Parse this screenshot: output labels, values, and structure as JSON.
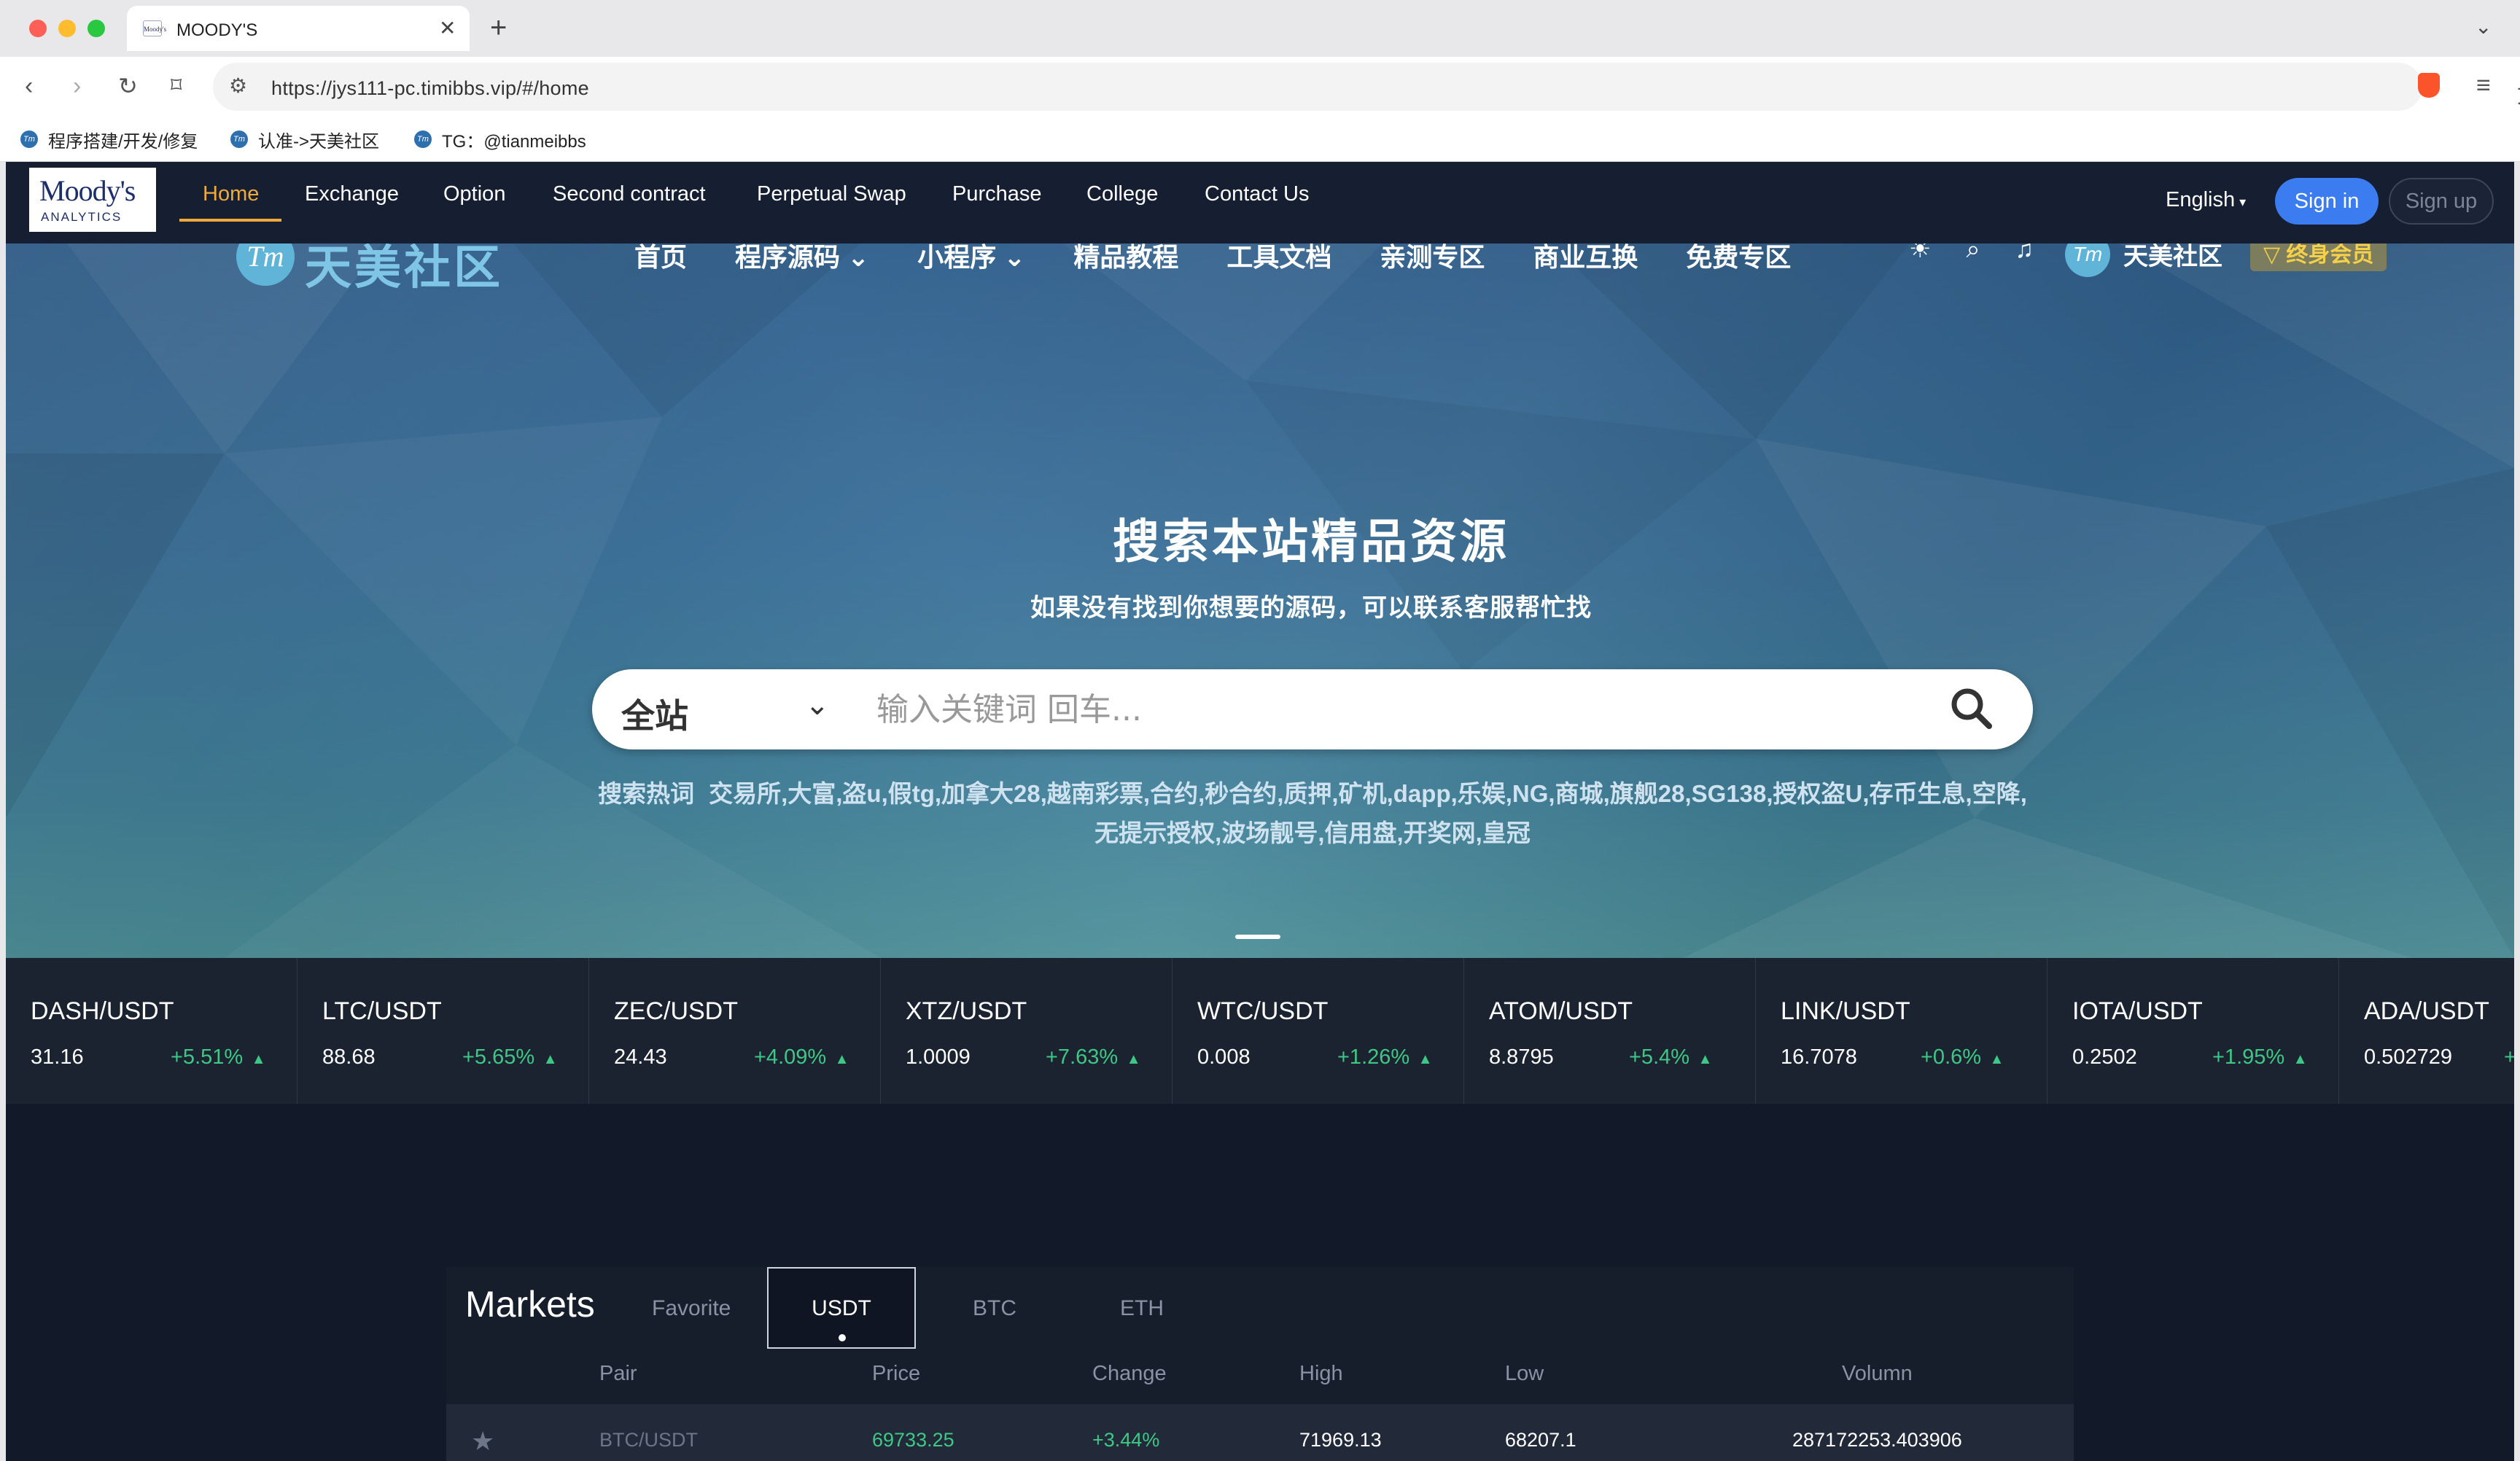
{
  "browser": {
    "tab_title": "MOODY'S",
    "tab_favicon_text": "Moody's",
    "url": "https://jys111-pc.timibbs.vip/#/home",
    "bookmarks": [
      {
        "label": "程序搭建/开发/修复",
        "icon_text": "Tm"
      },
      {
        "label": "认准->天美社区",
        "icon_text": "Tm"
      },
      {
        "label": "TG：@tianmeibbs",
        "icon_text": "Tm"
      }
    ]
  },
  "navbar": {
    "logo_line1": "Moody's",
    "logo_line2": "ANALYTICS",
    "items": [
      "Home",
      "Exchange",
      "Option",
      "Second contract",
      "Perpetual Swap",
      "Purchase",
      "College",
      "Contact Us"
    ],
    "language": "English",
    "sign_in": "Sign in",
    "sign_up": "Sign up",
    "accent_color": "#f0a93b",
    "button_color": "#3b7cf0"
  },
  "bg_site": {
    "logo_badge": "Tm",
    "logo_text": "天美社区",
    "nav": [
      "首页",
      "程序源码 ⌄",
      "小程序 ⌄",
      "精品教程",
      "工具文档",
      "亲测专区",
      "商业互换",
      "免费专区"
    ],
    "user_badge": "Tm",
    "user_name": "天美社区",
    "vip_label": "▽ 终身会员"
  },
  "hero": {
    "title": "搜索本站精品资源",
    "subtitle": "如果没有找到你想要的源码，可以联系客服帮忙找",
    "scope": "全站",
    "search_placeholder": "输入关键词 回车...",
    "hot_label": "搜索热词",
    "hot_words": "交易所,大富,盗u,假tg,加拿大28,越南彩票,合约,秒合约,质押,矿机,dapp,乐娱,NG,商城,旗舰28,SG138,授权盗U,存币生息,空降,无提示授权,波场靓号,信用盘,开奖网,皇冠"
  },
  "ticker": [
    {
      "pair": "DASH/USDT",
      "price": "31.16",
      "change": "+5.51%"
    },
    {
      "pair": "LTC/USDT",
      "price": "88.68",
      "change": "+5.65%"
    },
    {
      "pair": "ZEC/USDT",
      "price": "24.43",
      "change": "+4.09%"
    },
    {
      "pair": "XTZ/USDT",
      "price": "1.0009",
      "change": "+7.63%"
    },
    {
      "pair": "WTC/USDT",
      "price": "0.008",
      "change": "+1.26%"
    },
    {
      "pair": "ATOM/USDT",
      "price": "8.8795",
      "change": "+5.4%"
    },
    {
      "pair": "LINK/USDT",
      "price": "16.7078",
      "change": "+0.6%"
    },
    {
      "pair": "IOTA/USDT",
      "price": "0.2502",
      "change": "+1.95%"
    },
    {
      "pair": "ADA/USDT",
      "price": "0.502729",
      "change": "+"
    }
  ],
  "markets": {
    "title": "Markets",
    "tabs": [
      "Favorite",
      "USDT",
      "BTC",
      "ETH"
    ],
    "active_tab": "USDT",
    "columns": [
      "Pair",
      "Price",
      "Change",
      "High",
      "Low",
      "Volumn"
    ],
    "rows": [
      {
        "pair": "BTC/USDT",
        "price": "69733.25",
        "change": "+3.44%",
        "high": "71969.13",
        "low": "68207.1",
        "volume": "287172253.403906"
      }
    ],
    "up_color": "#3dc985"
  }
}
